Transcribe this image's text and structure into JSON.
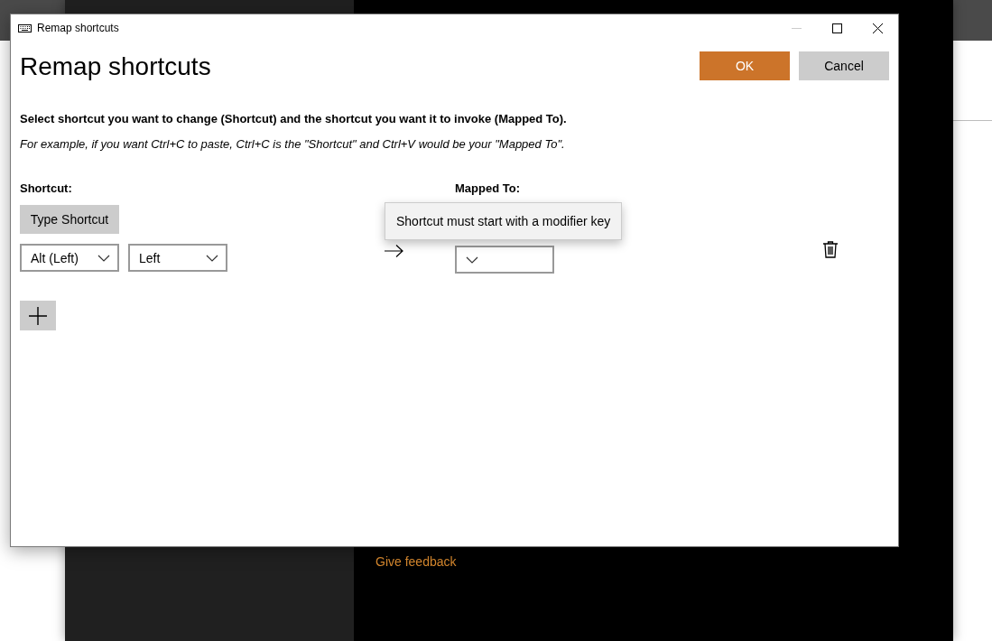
{
  "background_app": {
    "link": "Give feedback"
  },
  "dialog": {
    "title": "Remap shortcuts",
    "minimize_disabled": true,
    "heading": "Remap shortcuts",
    "buttons": [
      {
        "label": "OK",
        "kind": "primary"
      },
      {
        "label": "Cancel",
        "kind": "secondary"
      }
    ],
    "instruction": "Select shortcut you want to change (Shortcut) and the shortcut you want it to invoke (Mapped To).",
    "example": "For example, if you want Ctrl+C to paste, Ctrl+C is the \"Shortcut\" and Ctrl+V would be your \"Mapped To\".",
    "columns": [
      "Shortcut:",
      "Mapped To:"
    ],
    "type_shortcut_button": "Type Shortcut",
    "rows": [
      {
        "shortcut_keys": [
          "Alt (Left)",
          "Left"
        ]
      }
    ],
    "tooltip": "Shortcut must start with a modifier key"
  }
}
